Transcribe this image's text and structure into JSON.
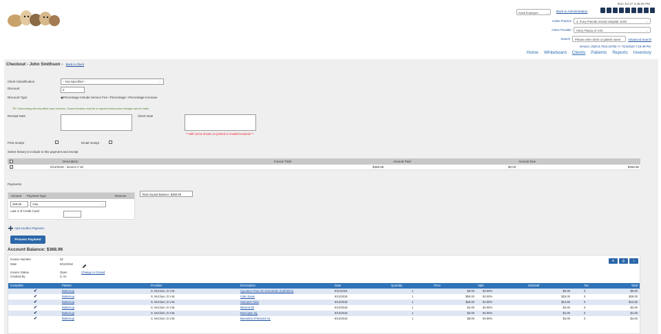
{
  "header": {
    "datetime": "Mon Jul 27 3:49:45 PM",
    "kiosk_select": "Kiosk Employee",
    "back_admin": "Back to Administration",
    "active_practice_label": "Active Practice",
    "active_practice_value": "3. Furry Friends Animal Hospital .SAM",
    "active_provider_label": "Active Provider",
    "active_provider_value": "Harry Pausa, D.V.M.",
    "search_label": "Search",
    "search_placeholder": "Please enter client or patient name",
    "advanced_search": "Advanced Search",
    "version": "Version: 2020.8.7510.34793 <> 7/24/2020 7:19:49 PM",
    "nav": [
      "Home",
      "Whiteboard",
      "Clients",
      "Patients",
      "Reports",
      "Inventory"
    ]
  },
  "page": {
    "title": "Checkout - John Smithson -",
    "back_client": "Back to Client",
    "client_classification_label": "Client Classification",
    "client_classification_value": "-- Not Specified --",
    "discount_label": "Discount",
    "discount_value": "0",
    "discount_type_label": "Discount Type",
    "discount_type_options": "◉Percentage Include Service Fee ○Percentage ○Percentage Increase",
    "tip": "TIP: Discounting will only affect open invoices. Closed invoices must be re-opened before price changes can be made.",
    "receipt_note_label": "Receipt Note",
    "client_note_label": "Client Note",
    "client_note_warning": "** Will not be shown on printed or emailed material **",
    "print_receipt_label": "Print receipt",
    "email_receipt_label": "Email receipt",
    "select_history_label": "Select history to include in this payment and receipt",
    "inv_headers": [
      "Description",
      "Invoice Total",
      "Amount Paid",
      "Amount Due"
    ],
    "inv_row": {
      "description": "9/11/2018 - Invoice # 32",
      "invoice_total": "$368.96",
      "amount_paid": "$0.00",
      "amount_due": "$368.96"
    },
    "payments_label": "Payments",
    "pay_headers": {
      "amount": "Amount",
      "payment_type": "Payment Type",
      "remove": "Remove"
    },
    "pay_amount": "368.96",
    "pay_type": "Visa",
    "last4_label": "Last 4 of Credit Card:",
    "total_unpaid": "Total Unpaid Balance: $368.96",
    "add_payment": "Add Another Payment",
    "process_payment": "Process Payment",
    "account_balance": "Account Balance: $368.96"
  },
  "detail": {
    "invoice_number_label": "Invoice Number",
    "invoice_number": "32",
    "date_label": "Date",
    "date": "9/11/2018",
    "status_label": "Invoice Status",
    "status": "Open",
    "change_closed": "Change to Closed",
    "created_by_label": "Created By",
    "created_by": "S. M.",
    "columns": [
      "Complete",
      "Patient",
      "Provider",
      "Description",
      "Date",
      "Quantity",
      "Price",
      "Split",
      "Subtotal",
      "Tax",
      "Total"
    ],
    "rows": [
      {
        "patient": "Buttercup",
        "provider": "S. McClure, D.V.M.",
        "description": "CyLamex Pour-On Insecticide (Cyfluthrin)",
        "date": "9/11/2018",
        "qty": "1",
        "price": "$0.00",
        "split": "50.00%",
        "subtotal": "$0.00",
        "tax": "0",
        "total": "$0.00"
      },
      {
        "patient": "Buttercup",
        "provider": "S. McClure, D.V.M.",
        "description": "Colic Exam",
        "date": "9/12/2018",
        "qty": "1",
        "price": "$50.00",
        "split": "50.00%",
        "subtotal": "$25.00",
        "tax": "0",
        "total": "$25.00"
      },
      {
        "patient": "Buttercup",
        "provider": "S. McClure, D.V.M.",
        "description": "Stomach Tube",
        "date": "9/12/2018",
        "qty": "1",
        "price": "$25.00",
        "split": "50.00%",
        "subtotal": "$12.50",
        "tax": "0",
        "total": "$12.50"
      },
      {
        "patient": "Buttercup",
        "provider": "S. McClure, D.V.M.",
        "description": "Mineral Oil",
        "date": "9/12/2018",
        "qty": "1",
        "price": "$4.00",
        "split": "50.00%",
        "subtotal": "$2.00",
        "tax": "0",
        "total": "$2.00"
      },
      {
        "patient": "Buttercup",
        "provider": "S. McClure, D.V.M.",
        "description": "Buscopan Inj.",
        "date": "9/12/2018",
        "qty": "1",
        "price": "$2.00",
        "split": "50.00%",
        "subtotal": "$1.00",
        "tax": "0",
        "total": "$1.00"
      },
      {
        "patient": "Buttercup",
        "provider": "S. McClure, D.V.M.",
        "description": "Banamine (Flunixin) Inj.",
        "date": "9/12/2018",
        "qty": "1",
        "price": "$8.00",
        "split": "50.00%",
        "subtotal": "$4.00",
        "tax": "0",
        "total": "$4.00"
      }
    ]
  }
}
